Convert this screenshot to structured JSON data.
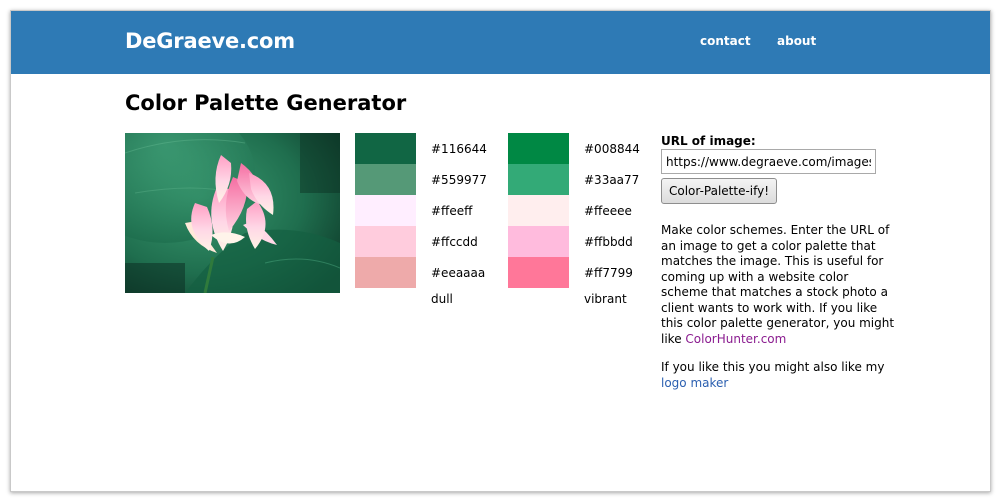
{
  "header": {
    "brand": "DeGraeve.com",
    "nav": {
      "contact": "contact",
      "about": "about"
    },
    "background_color": "#2e7ab5"
  },
  "page": {
    "title": "Color Palette Generator"
  },
  "image": {
    "subject": "pink lotus flower over green lotus leaves"
  },
  "palettes": {
    "dull": {
      "caption": "dull",
      "colors": [
        "#116644",
        "#559977",
        "#ffeeff",
        "#ffccdd",
        "#eeaaaa"
      ]
    },
    "vibrant": {
      "caption": "vibrant",
      "colors": [
        "#008844",
        "#33aa77",
        "#ffeeee",
        "#ffbbdd",
        "#ff7799"
      ]
    }
  },
  "form": {
    "label": "URL of image:",
    "url_value": "https://www.degraeve.com/images/lo",
    "submit_label": "Color-Palette-ify!"
  },
  "sidebar": {
    "description_lines": [
      "Make color schemes. Enter the URL of",
      "an image to get a color palette that",
      "matches the image. This is useful for",
      "coming up with a website color",
      "scheme that matches a stock photo a",
      "client wants to work with. If you like",
      "this color palette generator, you might"
    ],
    "like_prefix": "like ",
    "colorhunter_link": "ColorHunter.com",
    "also_like_text": "If you like this you might also like my",
    "logo_maker_link": "logo maker",
    "link_colors": {
      "visited": "#8a1b8f",
      "link": "#2b5fb0"
    }
  }
}
